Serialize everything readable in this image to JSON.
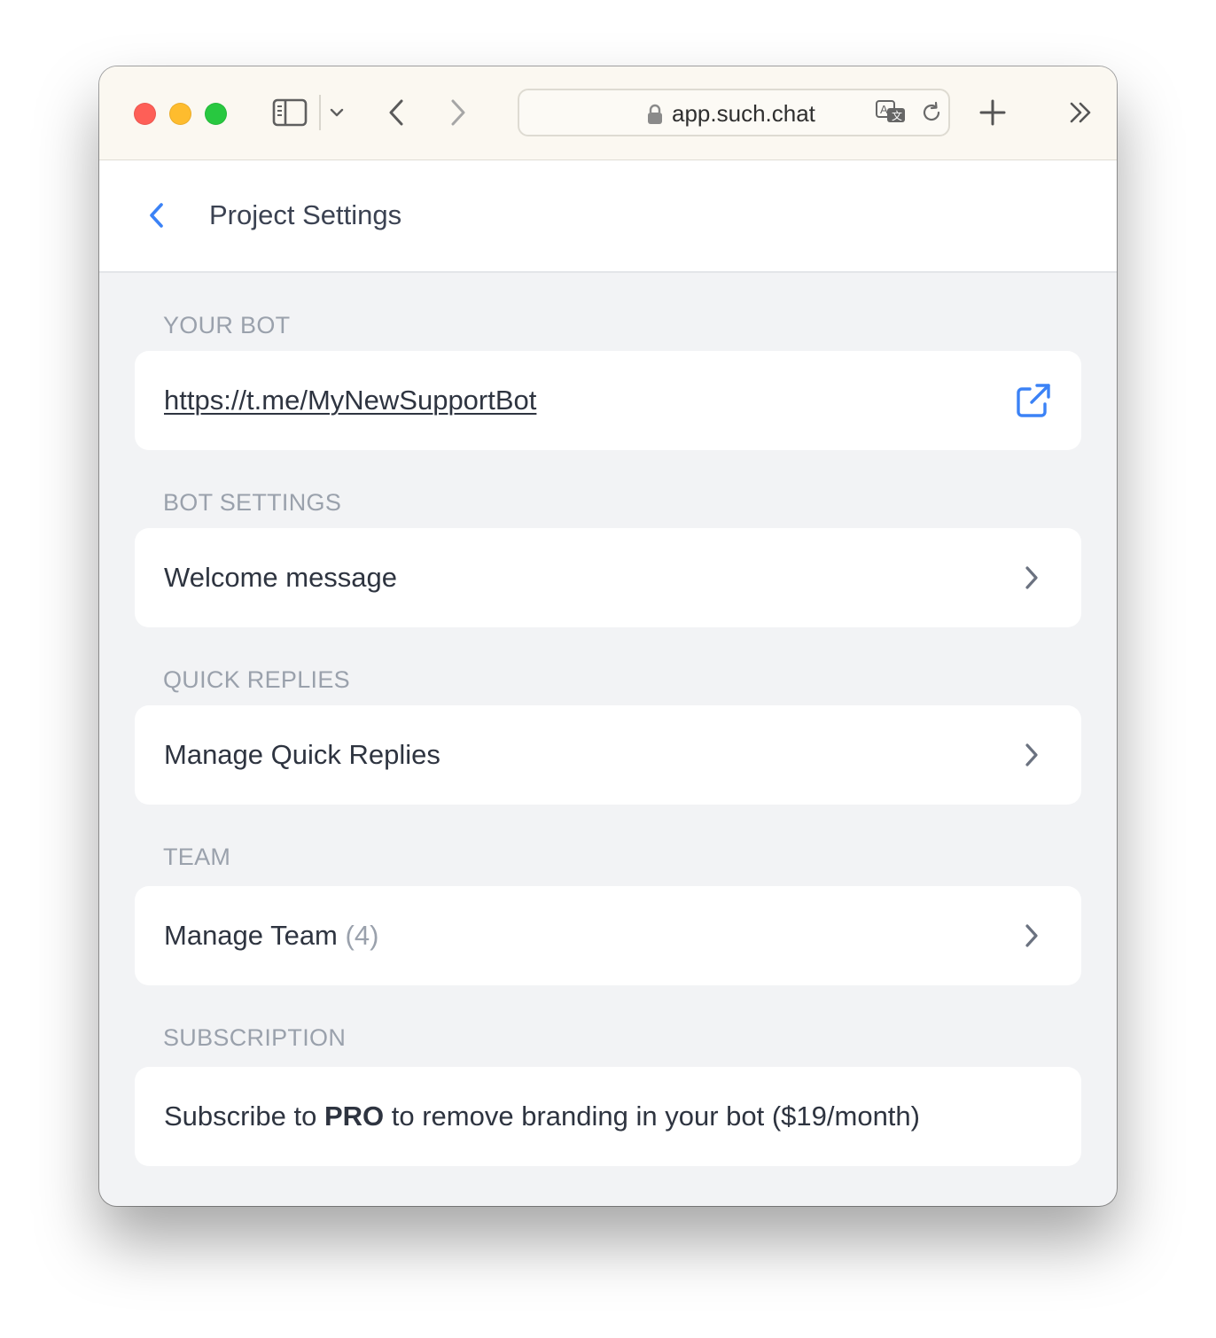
{
  "browser": {
    "url": "app.such.chat",
    "icons": {
      "sidebar": "sidebar-icon",
      "dropdown": "chevron-down-icon",
      "back": "chevron-left-icon",
      "forward": "chevron-right-icon",
      "lock": "lock-icon",
      "translate": "translate-icon",
      "reload": "reload-icon",
      "new_tab": "plus-icon",
      "overflow": "double-chevron-right-icon"
    },
    "traffic_lights": {
      "close": "#fe5f57",
      "minimize": "#febc2e",
      "zoom": "#28c840"
    }
  },
  "header": {
    "title": "Project Settings",
    "back_icon": "chevron-left-icon"
  },
  "sections": {
    "bot": {
      "label": "YOUR BOT",
      "link": "https://t.me/MyNewSupportBot",
      "icon": "external-link-icon"
    },
    "bot_settings": {
      "label": "BOT SETTINGS",
      "item": "Welcome message"
    },
    "quick_replies": {
      "label": "QUICK REPLIES",
      "item": "Manage Quick Replies"
    },
    "team": {
      "label": "TEAM",
      "item": "Manage Team",
      "count": "(4)"
    },
    "subscription": {
      "label": "SUBSCRIPTION",
      "text_before": "Subscribe to",
      "plan": "PRO",
      "text_after": "to remove branding in your bot ($19/month)"
    }
  },
  "colors": {
    "accent": "#3b82f6",
    "background": "#f2f3f5",
    "card": "#ffffff",
    "text": "#2e3440",
    "muted": "#9aa1ac"
  }
}
